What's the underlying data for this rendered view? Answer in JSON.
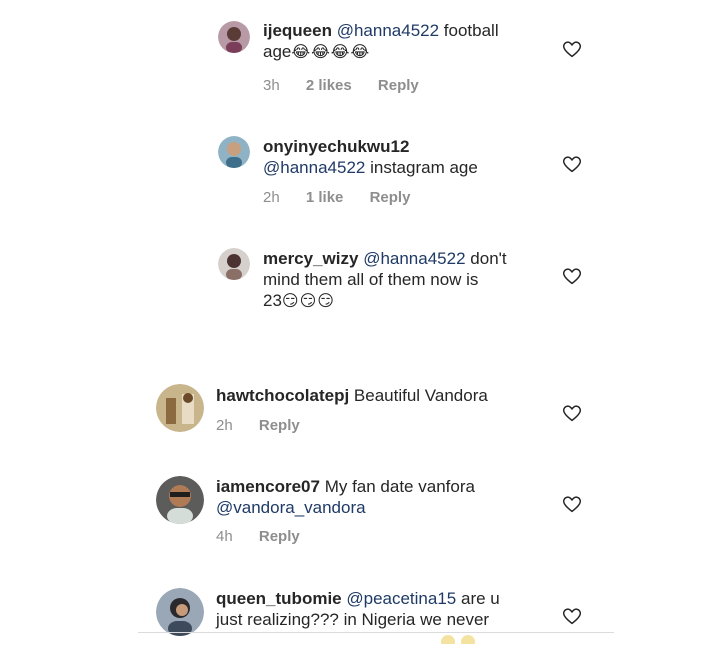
{
  "comments": [
    {
      "username": "ijequeen",
      "mention": "@hanna4522",
      "text_line1": "football",
      "text_line2": "age",
      "emoji": "😂😂😂😂",
      "time": "3h",
      "likes": "2 likes",
      "reply": "Reply",
      "avatar_icon": "avatar-icon"
    },
    {
      "username": "onyinyechukwu12",
      "mention": "@hanna4522",
      "text_line2": "instagram age",
      "time": "2h",
      "likes": "1 like",
      "reply": "Reply",
      "avatar_icon": "avatar-icon"
    },
    {
      "username": "mercy_wizy",
      "mention": "@hanna4522",
      "text_line1": "don't",
      "text_line2": "mind them all of them now is",
      "text_line3": "23",
      "emoji": "😏😏😏",
      "time": "2h",
      "reply": "Reply",
      "avatar_icon": "avatar-icon"
    },
    {
      "username": "hawtchocolatepj",
      "text_line1": "Beautiful Vandora",
      "time": "2h",
      "reply": "Reply",
      "avatar_icon": "avatar-icon"
    },
    {
      "username": "iamencore07",
      "text_line1": "My fan date vanfora",
      "mention": "@vandora_vandora",
      "time": "4h",
      "reply": "Reply",
      "avatar_icon": "avatar-icon"
    },
    {
      "username": "queen_tubomie",
      "mention": "@peacetina15",
      "text_line1": "are u",
      "text_line2": "just realizing??? in Nigeria we never",
      "avatar_icon": "avatar-icon"
    }
  ],
  "colors": {
    "text": "#262626",
    "meta": "#8e8e8e",
    "mention": "#1f3a66",
    "divider": "#dbdbdb"
  },
  "icons": [
    "heart-outline-icon",
    "avatar-icon"
  ]
}
